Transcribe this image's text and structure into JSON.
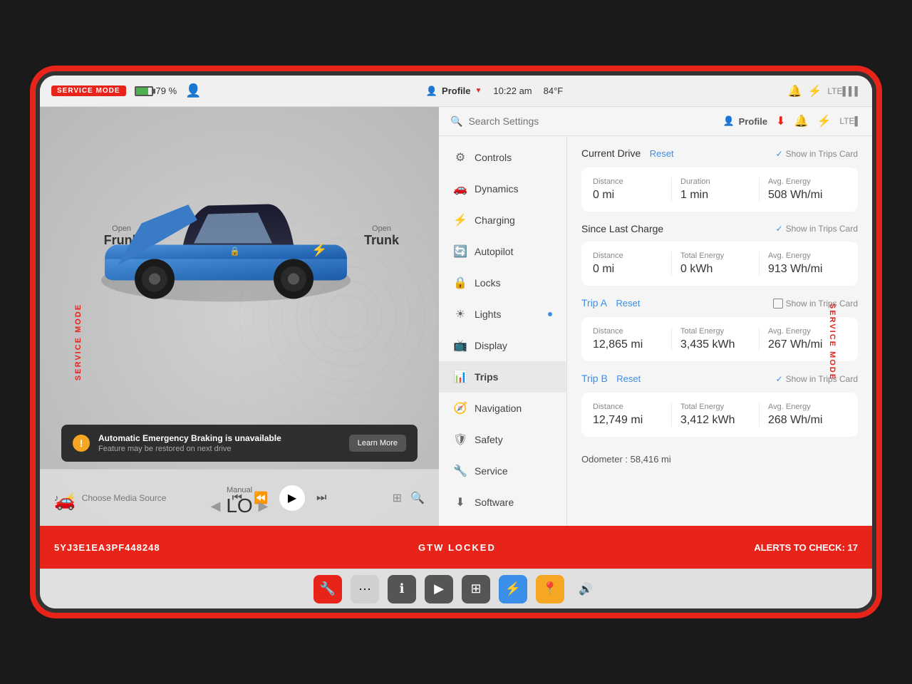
{
  "screen": {
    "mode_badge": "SERVICE MODE",
    "battery_percent": "79 %",
    "time": "10:22 am",
    "temperature": "84°F",
    "profile_label": "Profile"
  },
  "left_panel": {
    "frunk": {
      "open_label": "Open",
      "name": "Frunk"
    },
    "trunk": {
      "open_label": "Open",
      "name": "Trunk"
    },
    "alert": {
      "title": "Automatic Emergency Braking is unavailable",
      "subtitle": "Feature may be restored on next drive",
      "button_label": "Learn More"
    },
    "media": {
      "source_label": "Choose Media Source"
    },
    "gear": {
      "label": "Manual",
      "value": "LO"
    }
  },
  "right_panel": {
    "search_placeholder": "Search Settings",
    "profile_label": "Profile",
    "nav_items": [
      {
        "id": "controls",
        "icon": "⚙",
        "label": "Controls"
      },
      {
        "id": "dynamics",
        "icon": "🚗",
        "label": "Dynamics"
      },
      {
        "id": "charging",
        "icon": "⚡",
        "label": "Charging"
      },
      {
        "id": "autopilot",
        "icon": "🔄",
        "label": "Autopilot"
      },
      {
        "id": "locks",
        "icon": "🔒",
        "label": "Locks"
      },
      {
        "id": "lights",
        "icon": "💡",
        "label": "Lights",
        "dot": true
      },
      {
        "id": "display",
        "icon": "📺",
        "label": "Display"
      },
      {
        "id": "trips",
        "icon": "📊",
        "label": "Trips",
        "active": true
      },
      {
        "id": "navigation",
        "icon": "🧭",
        "label": "Navigation"
      },
      {
        "id": "safety",
        "icon": "🛡",
        "label": "Safety"
      },
      {
        "id": "service",
        "icon": "🔧",
        "label": "Service"
      },
      {
        "id": "software",
        "icon": "⬇",
        "label": "Software"
      }
    ],
    "trips": {
      "current_drive": {
        "title": "Current Drive",
        "reset_label": "Reset",
        "show_in_trips": "Show in Trips Card",
        "checked": true,
        "distance_label": "Distance",
        "distance_value": "0 mi",
        "duration_label": "Duration",
        "duration_value": "1 min",
        "avg_energy_label": "Avg. Energy",
        "avg_energy_value": "508 Wh/mi"
      },
      "since_last_charge": {
        "title": "Since Last Charge",
        "show_in_trips": "Show in Trips Card",
        "checked": true,
        "distance_label": "Distance",
        "distance_value": "0 mi",
        "total_energy_label": "Total Energy",
        "total_energy_value": "0 kWh",
        "avg_energy_label": "Avg. Energy",
        "avg_energy_value": "913 Wh/mi"
      },
      "trip_a": {
        "title": "Trip A",
        "reset_label": "Reset",
        "show_in_trips": "Show in Trips Card",
        "checked": false,
        "distance_label": "Distance",
        "distance_value": "12,865 mi",
        "total_energy_label": "Total Energy",
        "total_energy_value": "3,435 kWh",
        "avg_energy_label": "Avg. Energy",
        "avg_energy_value": "267 Wh/mi"
      },
      "trip_b": {
        "title": "Trip B",
        "reset_label": "Reset",
        "show_in_trips": "Show in Trips Card",
        "checked": true,
        "distance_label": "Distance",
        "distance_value": "12,749 mi",
        "total_energy_label": "Total Energy",
        "total_energy_value": "3,412 kWh",
        "avg_energy_label": "Avg. Energy",
        "avg_energy_value": "268 Wh/mi"
      },
      "odometer": {
        "label": "Odometer :",
        "value": "58,416 mi"
      }
    }
  },
  "bottom_bar": {
    "vin": "5YJ3E1EA3PF448248",
    "gtw_locked": "GTW LOCKED",
    "alerts_label": "ALERTS TO CHECK: 17"
  },
  "taskbar": {
    "icons": [
      "🔧",
      "···",
      "ℹ",
      "▶",
      "⊞",
      "🔵",
      "📍",
      "🔊"
    ]
  }
}
